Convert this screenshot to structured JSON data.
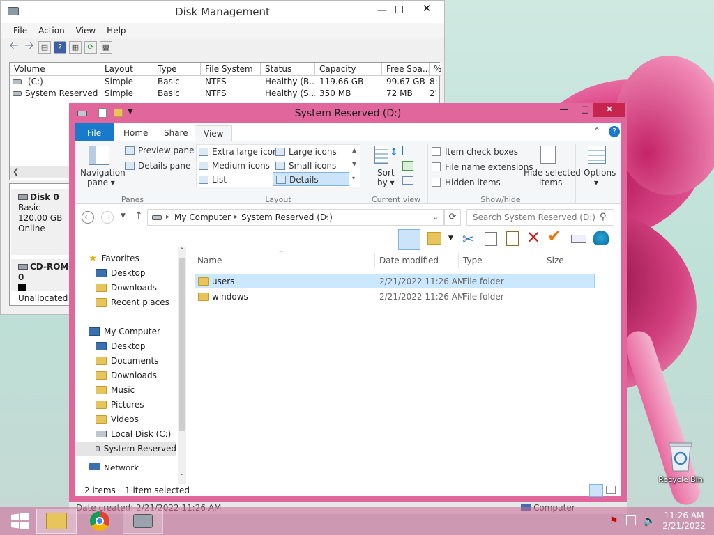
{
  "desktop": {
    "recycle_bin_label": "Recycle Bin"
  },
  "disk_management": {
    "title": "Disk Management",
    "menu": [
      "File",
      "Action",
      "View",
      "Help"
    ],
    "columns": [
      "Volume",
      "Layout",
      "Type",
      "File System",
      "Status",
      "Capacity",
      "Free Spa...",
      "%"
    ],
    "rows": [
      [
        "(C:)",
        "Simple",
        "Basic",
        "NTFS",
        "Healthy (B...",
        "119.66 GB",
        "99.67 GB",
        "8:"
      ],
      [
        "System Reserved (...",
        "Simple",
        "Basic",
        "NTFS",
        "Healthy (S...",
        "350 MB",
        "72 MB",
        "2'"
      ]
    ],
    "disk0": {
      "name": "Disk 0",
      "type": "Basic",
      "size": "120.00 GB",
      "status": "Online"
    },
    "cdrom": {
      "name": "CD-ROM 0",
      "status": "Unallocated"
    }
  },
  "explorer": {
    "title": "System Reserved (D:)",
    "tabs": [
      "File",
      "Home",
      "Share",
      "View"
    ],
    "ribbon": {
      "nav_pane": "Navigation",
      "nav_pane2": "pane",
      "preview_pane": "Preview pane",
      "details_pane": "Details pane",
      "panes_label": "Panes",
      "layout": [
        "Extra large icons",
        "Large icons",
        "Medium icons",
        "Small icons",
        "List",
        "Details"
      ],
      "layout_label": "Layout",
      "sort_by": "Sort",
      "sort_by2": "by",
      "current_view_label": "Current view",
      "item_check_boxes": "Item check boxes",
      "file_name_extensions": "File name extensions",
      "hidden_items": "Hidden items",
      "hide_selected": "Hide selected",
      "hide_selected2": "items",
      "showhide_label": "Show/hide",
      "options": "Options"
    },
    "address": {
      "seg1": "My Computer",
      "seg2": "System Reserved (D:)"
    },
    "search_placeholder": "Search System Reserved (D:)",
    "nav": {
      "favorites": "Favorites",
      "fav_items": [
        "Desktop",
        "Downloads",
        "Recent places"
      ],
      "computer": "My Computer",
      "pc_items": [
        "Desktop",
        "Documents",
        "Downloads",
        "Music",
        "Pictures",
        "Videos",
        "Local Disk (C:)",
        "System Reserved"
      ],
      "network": "Network"
    },
    "columns": [
      "Name",
      "Date modified",
      "Type",
      "Size"
    ],
    "files": [
      {
        "name": "users",
        "date": "2/21/2022 11:26 AM",
        "type": "File folder"
      },
      {
        "name": "windows",
        "date": "2/21/2022 11:26 AM",
        "type": "File folder"
      }
    ],
    "status": {
      "count": "2 items",
      "selected": "1 item selected"
    }
  },
  "status_strip": {
    "date_created": "Date created: 2/21/2022 11:26 AM",
    "computer": "Computer"
  },
  "taskbar": {
    "time": "11:26 AM",
    "date": "2/21/2022"
  }
}
